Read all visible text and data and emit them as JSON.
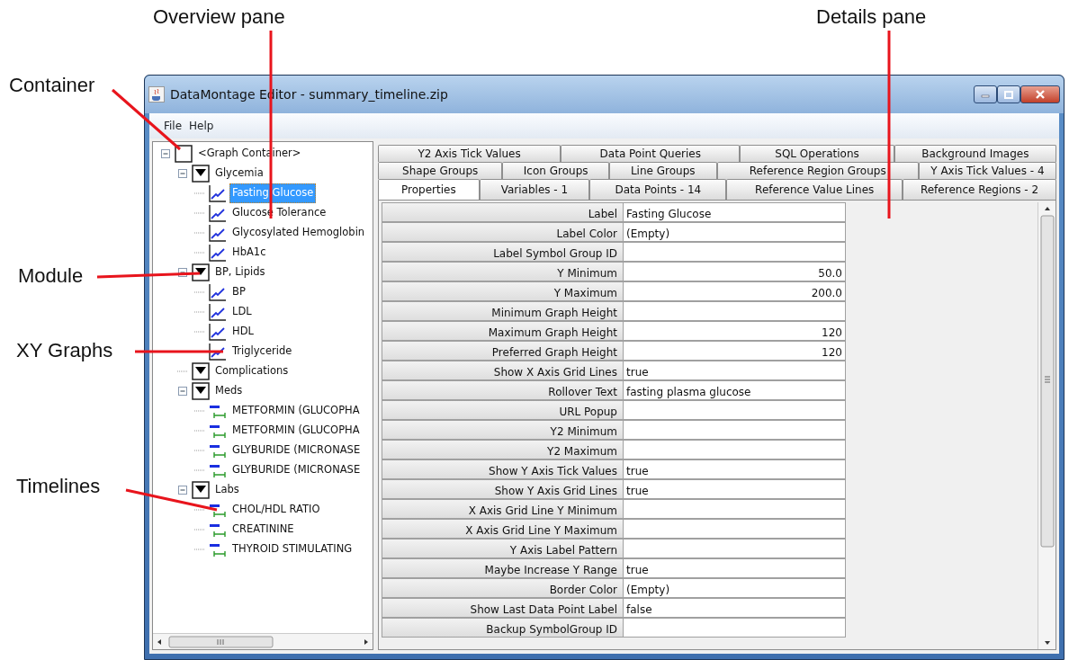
{
  "annotations": [
    {
      "label": "Overview pane"
    },
    {
      "label": "Details pane"
    },
    {
      "label": "Container"
    },
    {
      "label": "Module"
    },
    {
      "label": "XY Graphs"
    },
    {
      "label": "Timelines"
    }
  ],
  "window": {
    "title": "DataMontage Editor - summary_timeline.zip"
  },
  "menu": [
    "File",
    "Help"
  ],
  "tree": [
    {
      "label": "<Graph Container>",
      "kind": "container",
      "selected": false,
      "expanded": true,
      "children": [
        {
          "label": "Glycemia",
          "kind": "module",
          "selected": false,
          "expanded": true,
          "children": [
            {
              "label": "Fasting Glucose",
              "kind": "graph",
              "selected": true
            },
            {
              "label": "Glucose Tolerance",
              "kind": "graph",
              "selected": false
            },
            {
              "label": "Glycosylated Hemoglobin",
              "kind": "graph",
              "selected": false
            },
            {
              "label": "HbA1c",
              "kind": "graph",
              "selected": false
            }
          ]
        },
        {
          "label": "BP, Lipids",
          "kind": "module",
          "selected": false,
          "expanded": true,
          "children": [
            {
              "label": "BP",
              "kind": "graph",
              "selected": false
            },
            {
              "label": "LDL",
              "kind": "graph",
              "selected": false
            },
            {
              "label": "HDL",
              "kind": "graph",
              "selected": false
            },
            {
              "label": "Triglyceride",
              "kind": "graph",
              "selected": false
            }
          ]
        },
        {
          "label": "Complications",
          "kind": "module",
          "selected": false
        },
        {
          "label": "Meds",
          "kind": "module",
          "selected": false,
          "expanded": true,
          "children": [
            {
              "label": "METFORMIN (GLUCOPHA",
              "kind": "timeline",
              "selected": false
            },
            {
              "label": "METFORMIN (GLUCOPHA",
              "kind": "timeline",
              "selected": false
            },
            {
              "label": "GLYBURIDE (MICRONASE",
              "kind": "timeline",
              "selected": false
            },
            {
              "label": "GLYBURIDE (MICRONASE",
              "kind": "timeline",
              "selected": false
            }
          ]
        },
        {
          "label": "Labs",
          "kind": "module",
          "selected": false,
          "expanded": true,
          "children": [
            {
              "label": "CHOL/HDL RATIO",
              "kind": "timeline",
              "selected": false
            },
            {
              "label": "CREATININE",
              "kind": "timeline",
              "selected": false
            },
            {
              "label": "THYROID STIMULATING",
              "kind": "timeline",
              "selected": false
            }
          ]
        }
      ]
    }
  ],
  "tab_rows": [
    [
      {
        "label": "Y2 Axis Tick Values",
        "selected": false
      },
      {
        "label": "Data Point Queries",
        "selected": false
      },
      {
        "label": "SQL Operations",
        "selected": false
      },
      {
        "label": "Background Images",
        "selected": false
      }
    ],
    [
      {
        "label": "Shape Groups",
        "selected": false
      },
      {
        "label": "Icon Groups",
        "selected": false
      },
      {
        "label": "Line Groups",
        "selected": false
      },
      {
        "label": "Reference Region Groups",
        "selected": false
      },
      {
        "label": "Y Axis Tick Values - 4",
        "selected": false
      }
    ],
    [
      {
        "label": "Properties",
        "selected": true
      },
      {
        "label": "Variables - 1",
        "selected": false
      },
      {
        "label": "Data Points - 14",
        "selected": false
      },
      {
        "label": "Reference Value Lines",
        "selected": false
      },
      {
        "label": "Reference Regions - 2",
        "selected": false
      }
    ]
  ],
  "properties": [
    {
      "name": "Label",
      "value": "Fasting Glucose",
      "kind": "text"
    },
    {
      "name": "Label Color",
      "value": "(Empty)",
      "kind": "text"
    },
    {
      "name": "Label Symbol Group ID",
      "kind": "text"
    },
    {
      "name": "Y Minimum",
      "value": "50.0",
      "kind": "number"
    },
    {
      "name": "Y Maximum",
      "value": "200.0",
      "kind": "number"
    },
    {
      "name": "Minimum Graph Height",
      "kind": "number"
    },
    {
      "name": "Maximum Graph Height",
      "value": "120",
      "kind": "number"
    },
    {
      "name": "Preferred Graph Height",
      "value": "120",
      "kind": "number"
    },
    {
      "name": "Show X Axis Grid Lines",
      "value": "true",
      "kind": "text"
    },
    {
      "name": "Rollover Text",
      "value": "fasting plasma glucose",
      "kind": "text"
    },
    {
      "name": "URL Popup",
      "kind": "text"
    },
    {
      "name": "Y2 Minimum",
      "kind": "number"
    },
    {
      "name": "Y2 Maximum",
      "kind": "number"
    },
    {
      "name": "Show Y Axis Tick Values",
      "value": "true",
      "kind": "text"
    },
    {
      "name": "Show Y Axis Grid Lines",
      "value": "true",
      "kind": "text"
    },
    {
      "name": "X Axis Grid Line Y Minimum",
      "kind": "number"
    },
    {
      "name": "X Axis Grid Line Y Maximum",
      "kind": "number"
    },
    {
      "name": "Y Axis Label Pattern",
      "kind": "text"
    },
    {
      "name": "Maybe Increase Y Range",
      "value": "true",
      "kind": "text"
    },
    {
      "name": "Border Color",
      "value": "(Empty)",
      "kind": "text"
    },
    {
      "name": "Show Last Data Point Label",
      "value": "false",
      "kind": "text"
    },
    {
      "name": "Backup SymbolGroup ID",
      "kind": "text"
    }
  ]
}
